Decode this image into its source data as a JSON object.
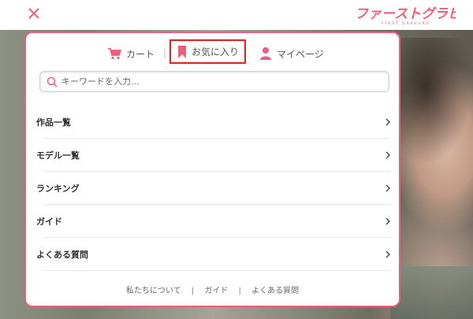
{
  "header": {
    "close_icon": "close-icon",
    "logo_text": "ファーストグラビア",
    "logo_subtext": "FIRST GRAVURE",
    "brand_color": "#e8607d"
  },
  "modal": {
    "top_nav": [
      {
        "label": "カート",
        "icon": "cart-icon"
      },
      {
        "label": "お気に入り",
        "icon": "bookmark-icon",
        "highlighted": true
      },
      {
        "label": "マイページ",
        "icon": "user-icon"
      }
    ],
    "separator": "|",
    "search": {
      "placeholder": "キーワードを入力...",
      "value": "",
      "icon": "search-icon"
    },
    "menu": [
      {
        "label": "作品一覧"
      },
      {
        "label": "モデル一覧"
      },
      {
        "label": "ランキング"
      },
      {
        "label": "ガイド"
      },
      {
        "label": "よくある質問"
      }
    ],
    "footer_links": [
      {
        "label": "私たちについて"
      },
      {
        "label": "ガイド"
      },
      {
        "label": "よくある質問"
      }
    ],
    "footer_separator": "|"
  },
  "colors": {
    "accent": "#e8607d",
    "highlight_box": "#e02020"
  }
}
